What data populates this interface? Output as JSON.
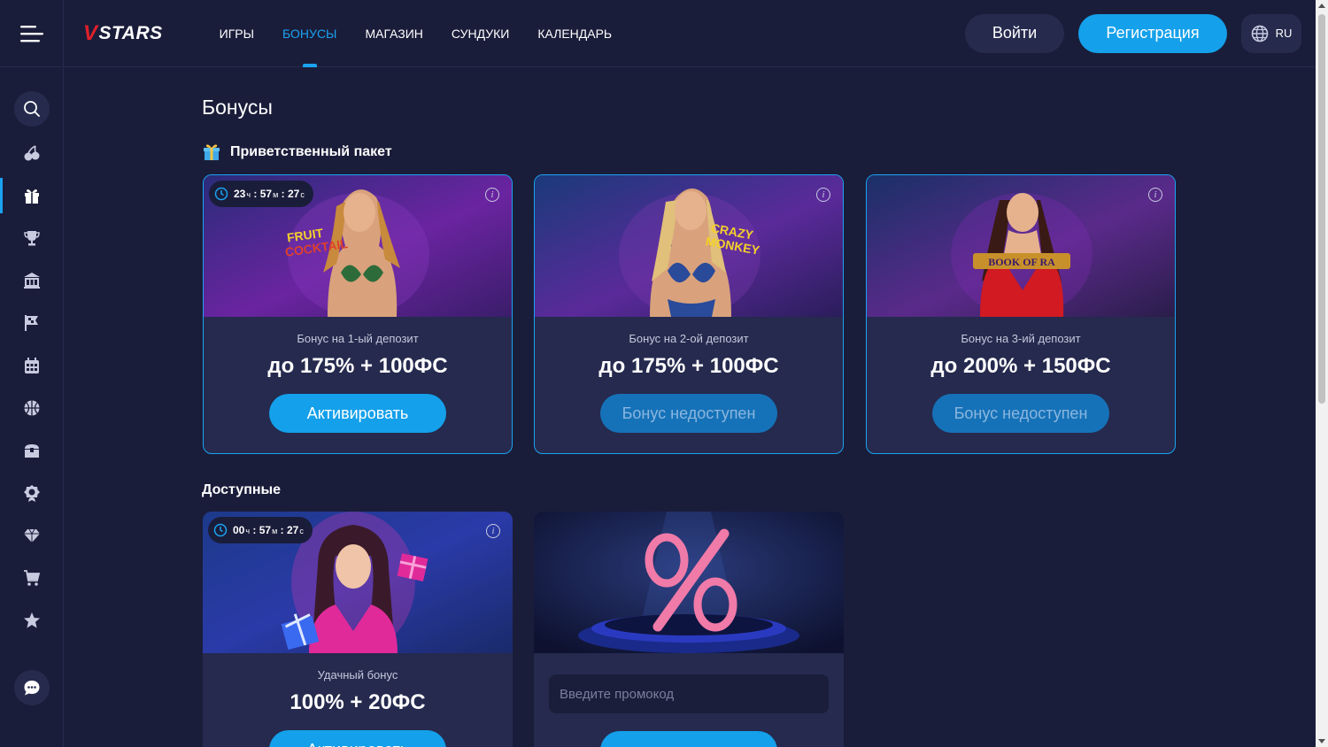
{
  "header": {
    "logo_text": "STARS",
    "logo_mark": "V",
    "nav": [
      {
        "label": "ИГРЫ",
        "active": false
      },
      {
        "label": "БОНУСЫ",
        "active": true
      },
      {
        "label": "МАГАЗИН",
        "active": false
      },
      {
        "label": "СУНДУКИ",
        "active": false
      },
      {
        "label": "КАЛЕНДАРЬ",
        "active": false
      }
    ],
    "login_label": "Войти",
    "register_label": "Регистрация",
    "language": "RU"
  },
  "sidebar": {
    "items": [
      "search-icon",
      "cherries-icon",
      "gift-icon",
      "trophy-icon",
      "casino-icon",
      "flag-icon",
      "calendar-icon",
      "basketball-icon",
      "chest-icon",
      "badge-icon",
      "diamond-icon",
      "cart-icon",
      "star-icon"
    ],
    "active_item": "gift-icon",
    "chat_icon": "chat-icon"
  },
  "page": {
    "title": "Бонусы",
    "welcome_section": "Приветственный пакет",
    "available_section": "Доступные"
  },
  "welcome_cards": [
    {
      "timer": {
        "h": "23",
        "m": "57",
        "s": "27"
      },
      "subtitle": "Бонус на 1-ый депозит",
      "title": "до 175% + 100ФС",
      "button": "Активировать",
      "enabled": true
    },
    {
      "subtitle": "Бонус на 2-ой депозит",
      "title": "до 175% + 100ФС",
      "button": "Бонус недоступен",
      "enabled": false
    },
    {
      "subtitle": "Бонус на 3-ий депозит",
      "title": "до 200% + 150ФС",
      "button": "Бонус недоступен",
      "enabled": false
    }
  ],
  "available_cards": [
    {
      "timer": {
        "h": "00",
        "m": "57",
        "s": "27"
      },
      "subtitle": "Удачный бонус",
      "title": "100% + 20ФС",
      "button": "Активировать"
    },
    {
      "promo_placeholder": "Введите промокод"
    }
  ],
  "timer_units": {
    "h": "ч",
    "m": "м",
    "s": "с"
  },
  "colors": {
    "accent": "#14a0ea",
    "background": "#1a1d3a",
    "card": "#252a4e",
    "logo_red": "#e0202a"
  }
}
